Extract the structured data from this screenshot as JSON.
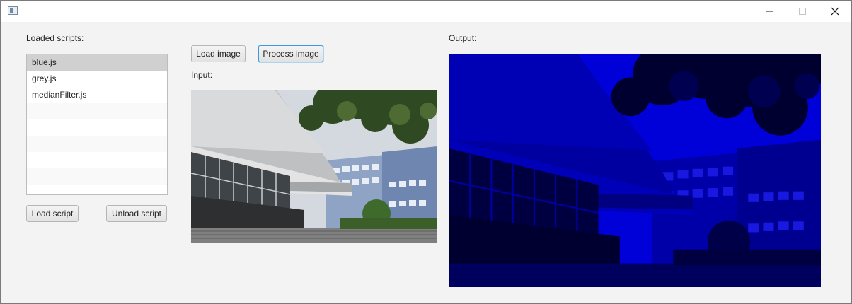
{
  "window": {
    "title": ""
  },
  "scripts_panel": {
    "label": "Loaded scripts:",
    "items": [
      {
        "label": "blue.js",
        "selected": true
      },
      {
        "label": "grey.js",
        "selected": false
      },
      {
        "label": "medianFilter.js",
        "selected": false
      }
    ],
    "load_button": "Load script",
    "unload_button": "Unload script"
  },
  "toolbar": {
    "load_image_button": "Load image",
    "process_image_button": "Process image"
  },
  "input_panel": {
    "label": "Input:"
  },
  "output_panel": {
    "label": "Output:",
    "tint": "#1414c8"
  },
  "colors": {
    "selection": "#d0d0d0",
    "focus_ring": "#3c9ad8",
    "window_bg": "#f3f3f3"
  }
}
